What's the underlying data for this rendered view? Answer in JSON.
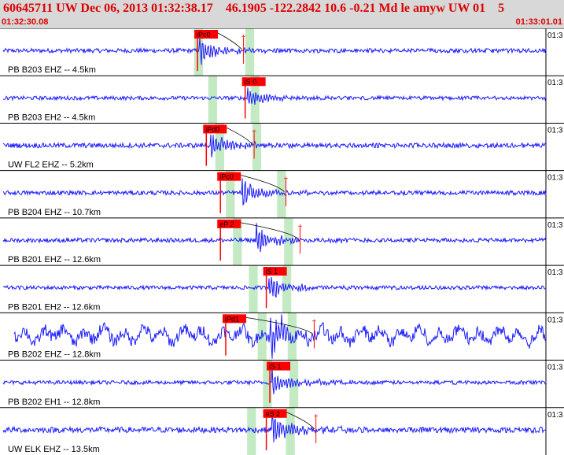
{
  "header": {
    "title": "60645711 UW Dec 06, 2013 01:32:38.17    46.1905 -122.2842 10.6 -0.21 Md le amyw UW 01    5",
    "start_time": "01:32:30.08",
    "end_time": "01:33:01.01"
  },
  "colors": {
    "trace": "#1a1aff",
    "pick": "#ff0000",
    "band": "#b8e6b8",
    "label": "#000000",
    "header_bg": "#d8d8d8",
    "header_text": "#dd0000"
  },
  "chart_data": {
    "type": "line",
    "x_unit": "time (01:32:30.08 to 01:33:01.01)",
    "xlim": [
      "01:32:30.08",
      "01:33:01.01"
    ],
    "grid": false,
    "right_tick_label": "01:3",
    "phase_bands": [
      {
        "phase": "P",
        "start_s": [
          11.0,
          11.8,
          12.2,
          12.8,
          13.2,
          14.1,
          14.6,
          14.9,
          14.0
        ]
      },
      {
        "phase": "S",
        "start_s": [
          13.9,
          14.2,
          14.3,
          15.7,
          16.1,
          16.0,
          16.3,
          16.4,
          16.2
        ]
      }
    ],
    "traces": [
      {
        "label": "PB B203 EHZ -- 4.5km",
        "pick": "iPc0",
        "pick_s": 11.1,
        "arrival_s": 11.3,
        "amplitude": 0.3,
        "noise": 0.09,
        "show_pick_mark": true
      },
      {
        "label": "PB B203 EH2 -- 4.5km",
        "pick": "iS 0",
        "pick_s": 13.8,
        "arrival_s": 14.0,
        "amplitude": 0.25,
        "noise": 0.08,
        "show_pick_mark": false
      },
      {
        "label": "UW FL2 EHZ -- 5.2km",
        "pick": "iPd0",
        "pick_s": 11.6,
        "arrival_s": 11.9,
        "amplitude": 0.3,
        "noise": 0.1,
        "show_pick_mark": true
      },
      {
        "label": "PB B204 EHZ -- 10.7km",
        "pick": "iPc0",
        "pick_s": 12.4,
        "arrival_s": 13.7,
        "amplitude": 0.35,
        "noise": 0.09,
        "show_pick_mark": true
      },
      {
        "label": "PB B201 EHZ -- 12.6km",
        "pick": "eP 2",
        "pick_s": 12.4,
        "arrival_s": 14.5,
        "amplitude": 0.3,
        "noise": 0.09,
        "show_pick_mark": true
      },
      {
        "label": "PB B201 EH2 -- 12.6km",
        "pick": "iS 1",
        "pick_s": 15.0,
        "arrival_s": 15.2,
        "amplitude": 0.3,
        "noise": 0.08,
        "show_pick_mark": false
      },
      {
        "label": "PB B202 EHZ -- 12.8km",
        "pick": "iPd1",
        "pick_s": 12.7,
        "arrival_s": 15.3,
        "amplitude": 0.45,
        "noise": 0.25,
        "show_pick_mark": true
      },
      {
        "label": "PB B202 EH1 -- 12.8km",
        "pick": "iS 1",
        "pick_s": 15.2,
        "arrival_s": 15.4,
        "amplitude": 0.35,
        "noise": 0.08,
        "show_pick_mark": false
      },
      {
        "label": "UW ELK EHZ -- 13.5km",
        "pick": "eS 2",
        "pick_s": 15.0,
        "arrival_s": 15.4,
        "amplitude": 0.35,
        "noise": 0.12,
        "show_pick_mark": true
      }
    ]
  }
}
